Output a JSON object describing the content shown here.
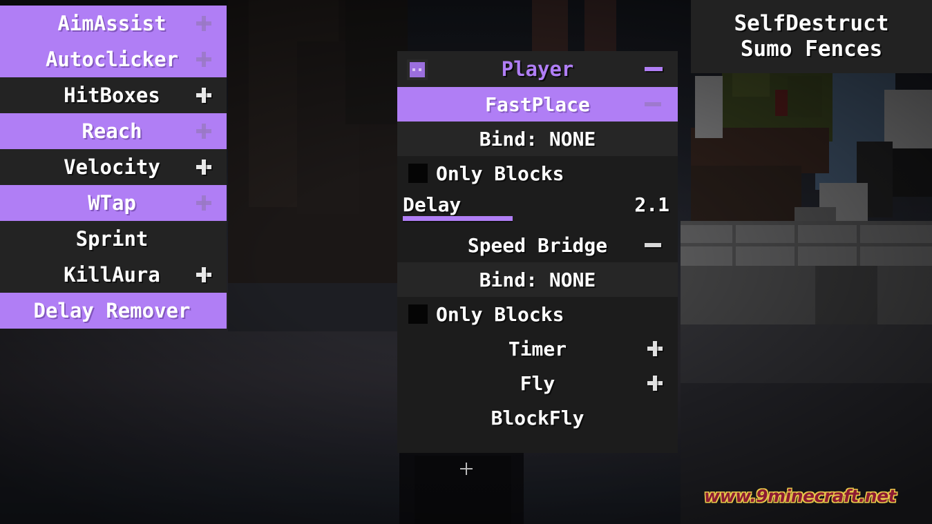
{
  "window_title": "Minecraft Client GUI",
  "colors": {
    "accent_purple": "#b07ef5",
    "panel_dark": "#1c1c1c",
    "row_dark": "#232323",
    "bind_row": "#262626",
    "text_white": "#ffffff",
    "watermark_fill": "#8c1b33",
    "watermark_outline": "#e8c84a"
  },
  "module_panel": {
    "name": "module-list",
    "items": [
      {
        "label": "AimAssist",
        "enabled": true,
        "has_expand": true,
        "icon": "plus-icon"
      },
      {
        "label": "Autoclicker",
        "enabled": true,
        "has_expand": true,
        "icon": "plus-icon"
      },
      {
        "label": "HitBoxes",
        "enabled": false,
        "has_expand": true,
        "icon": "plus-icon"
      },
      {
        "label": "Reach",
        "enabled": true,
        "has_expand": true,
        "icon": "plus-icon"
      },
      {
        "label": "Velocity",
        "enabled": false,
        "has_expand": true,
        "icon": "plus-icon"
      },
      {
        "label": "WTap",
        "enabled": true,
        "has_expand": true,
        "icon": "plus-icon"
      },
      {
        "label": "Sprint",
        "enabled": false,
        "has_expand": false,
        "icon": ""
      },
      {
        "label": "KillAura",
        "enabled": false,
        "has_expand": true,
        "icon": "plus-icon"
      },
      {
        "label": "Delay Remover",
        "enabled": true,
        "has_expand": false,
        "icon": ""
      }
    ]
  },
  "player_window": {
    "title": "Player",
    "icon": "player-head-icon",
    "collapse_icon": "minus-icon",
    "rows": [
      {
        "type": "module",
        "label": "FastPlace",
        "selected": true,
        "indicator": "minus-icon"
      },
      {
        "type": "bind",
        "label": "Bind: NONE",
        "selected": false,
        "indicator": ""
      },
      {
        "type": "checkbox",
        "label": "Only Blocks",
        "checked": false,
        "indicator": "checkbox-icon"
      },
      {
        "type": "slider",
        "label": "Delay",
        "value": "2.1",
        "fill_percent": 41
      },
      {
        "type": "module",
        "label": "Speed Bridge",
        "selected": false,
        "indicator": "minus-icon"
      },
      {
        "type": "bind",
        "label": "Bind: NONE",
        "selected": false,
        "indicator": ""
      },
      {
        "type": "checkbox",
        "label": "Only Blocks",
        "checked": false,
        "indicator": "checkbox-icon"
      },
      {
        "type": "module",
        "label": "Timer",
        "selected": false,
        "indicator": "plus-icon"
      },
      {
        "type": "module",
        "label": "Fly",
        "selected": false,
        "indicator": "plus-icon"
      },
      {
        "type": "module",
        "label": "BlockFly",
        "selected": false,
        "indicator": ""
      }
    ]
  },
  "top_right_panel": {
    "name": "server-info",
    "lines": [
      {
        "text": "SelfDestruct"
      },
      {
        "text": "Sumo Fences"
      }
    ]
  },
  "watermark": {
    "text": "www.9minecraft.net"
  },
  "hud": {
    "crosshair": "crosshair-icon"
  }
}
